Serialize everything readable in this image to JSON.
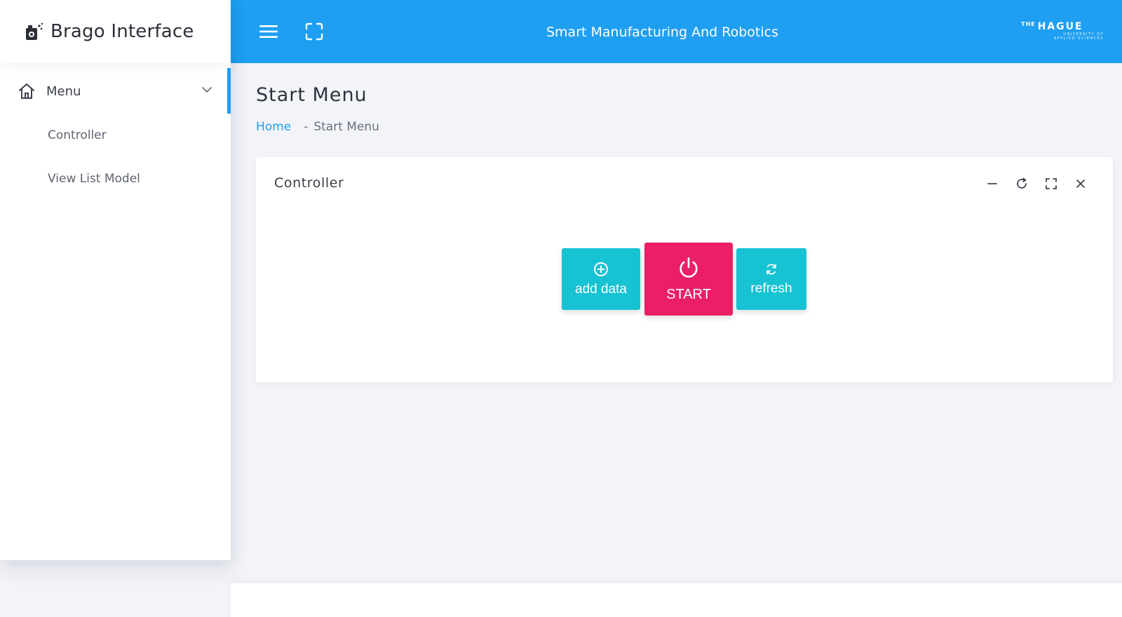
{
  "sidebar": {
    "brand_title": "Brago Interface",
    "menu_label": "Menu",
    "items": [
      {
        "label": "Controller"
      },
      {
        "label": "View List Model"
      }
    ]
  },
  "header": {
    "title": "Smart Manufacturing And Robotics",
    "logo": {
      "the": "THE",
      "name": "HAGUE",
      "line1": "UNIVERSITY OF",
      "line2": "APPLIED SCIENCES"
    }
  },
  "page": {
    "title": "Start Menu",
    "breadcrumb": {
      "home": "Home",
      "separator": "-",
      "current": "Start Menu"
    }
  },
  "card": {
    "title": "Controller",
    "buttons": {
      "add_data": "add data",
      "start": "START",
      "refresh": "refresh"
    }
  },
  "colors": {
    "accent": "#1e9ff2",
    "start_button": "#ea1f68",
    "secondary_button": "#17c2d3",
    "background": "#f3f4f9"
  },
  "icons": [
    "camera-sparkle-icon",
    "home-icon",
    "chevron-down-icon",
    "menu-icon",
    "expand-icon",
    "minus-icon",
    "reload-icon",
    "fullscreen-icon",
    "close-icon",
    "plus-circle-icon",
    "power-icon",
    "refresh-icon"
  ]
}
